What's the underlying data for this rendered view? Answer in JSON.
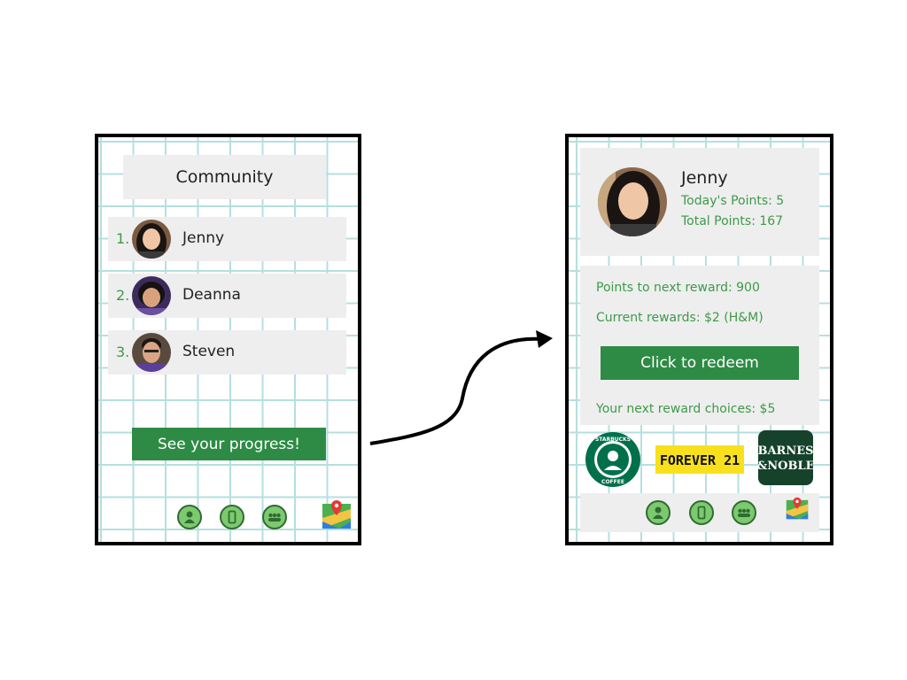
{
  "community_screen": {
    "title": "Community",
    "rankings": [
      {
        "rank": "1.",
        "name": "Jenny"
      },
      {
        "rank": "2.",
        "name": "Deanna"
      },
      {
        "rank": "3.",
        "name": "Steven"
      }
    ],
    "progress_button_label": "See your progress!",
    "nav_icons": [
      "person-icon",
      "phone-icon",
      "group-icon",
      "map-icon"
    ]
  },
  "progress_screen": {
    "user_name": "Jenny",
    "todays_points": "Today's Points: 5",
    "total_points": "Total Points: 167",
    "points_to_next_reward": "Points to next reward: 900",
    "current_rewards": "Current rewards: $2 (H&M)",
    "redeem_button_label": "Click to redeem",
    "next_reward_choices": "Your next reward choices: $5",
    "reward_brands": [
      "STARBUCKS COFFEE",
      "FOREVER 21",
      "BARNES & NOBLE"
    ],
    "nav_icons": [
      "person-icon",
      "phone-icon",
      "group-icon",
      "map-icon"
    ]
  },
  "colors": {
    "accent_green": "#2e8b45",
    "text_green": "#3d9a4a",
    "grid_line": "#b5dfe0",
    "panel_gray": "#eeeeee"
  }
}
